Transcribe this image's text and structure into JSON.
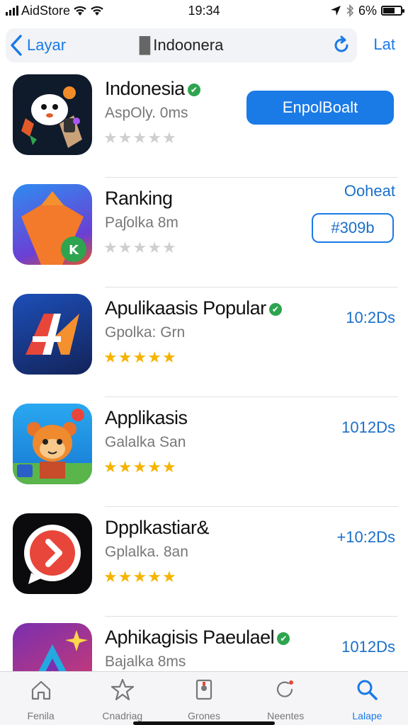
{
  "status_bar": {
    "carrier": "AidStore",
    "time": "19:34",
    "battery": "6%",
    "battery_level": 0.65
  },
  "nav": {
    "back_label": "Layar",
    "title": "Indoonera",
    "right_label": "Lat"
  },
  "apps": [
    {
      "name": "Indonesia",
      "subtitle": "AspOly. 0ms",
      "rating": 0,
      "verified": true,
      "action_type": "filled",
      "action_label": "EnpolBoalt"
    },
    {
      "name": "Ranking",
      "subtitle": "Paʃolka 8m",
      "rating": 0,
      "verified": false,
      "action_type": "outline",
      "action_top_label": "Ooheat",
      "action_label": "#309b"
    },
    {
      "name": "Apulikaasis Popular",
      "subtitle": "Gpolka: Grn",
      "rating": 5,
      "verified": true,
      "action_type": "text",
      "action_label": "10:2Ds"
    },
    {
      "name": "Applikasis",
      "subtitle": "Galalka San",
      "rating": 5,
      "verified": false,
      "action_type": "text",
      "action_label": "1012Ds"
    },
    {
      "name": "Dpplkastiar&",
      "subtitle": "Gplalka. 8an",
      "rating": 5,
      "verified": false,
      "action_type": "text",
      "action_label": "+10:2Ds"
    },
    {
      "name": "Aphikagisis Paeulael",
      "subtitle": "Bajalka 8ms",
      "rating": 0,
      "verified": true,
      "action_type": "text",
      "action_label": "1012Ds"
    }
  ],
  "tabs": [
    {
      "label": "Fenila",
      "icon": "home-icon",
      "active": false
    },
    {
      "label": "Cnadriag",
      "icon": "star-icon",
      "active": false
    },
    {
      "label": "Grones",
      "icon": "games-icon",
      "active": false
    },
    {
      "label": "Neentes",
      "icon": "updates-icon",
      "active": false
    },
    {
      "label": "Lalape",
      "icon": "search-icon",
      "active": true
    }
  ],
  "colors": {
    "accent": "#1a7ae6",
    "star": "#f5b400",
    "verified": "#2ea44f"
  }
}
